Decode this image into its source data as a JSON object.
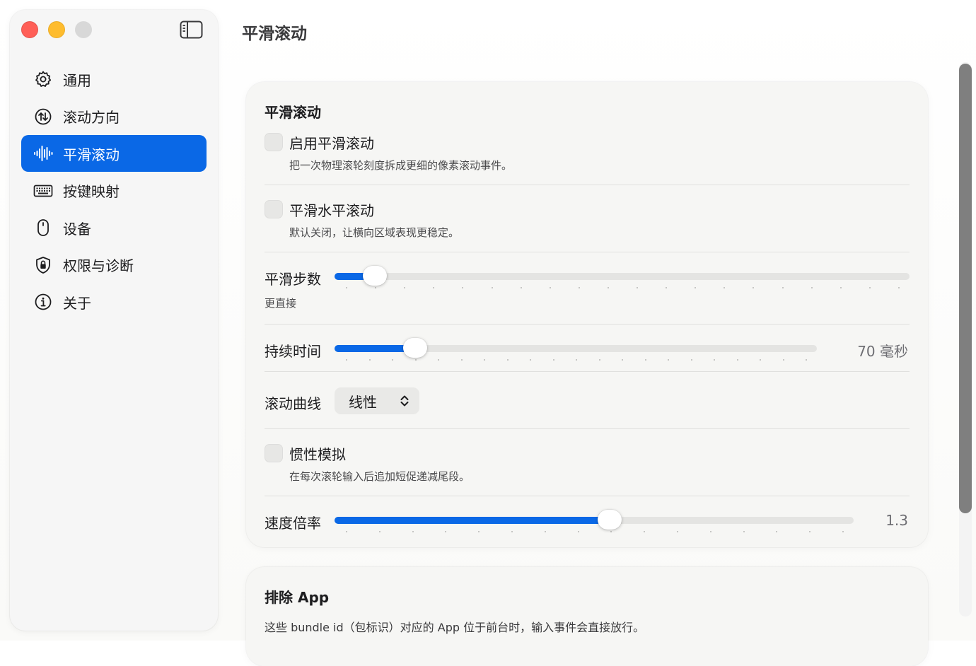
{
  "page": {
    "title": "平滑滚动"
  },
  "sidebar": {
    "items": [
      {
        "label": "通用",
        "icon": "gear-icon",
        "active": false
      },
      {
        "label": "滚动方向",
        "icon": "arrows-updown-circle-icon",
        "active": false
      },
      {
        "label": "平滑滚动",
        "icon": "waveform-icon",
        "active": true
      },
      {
        "label": "按键映射",
        "icon": "keyboard-icon",
        "active": false
      },
      {
        "label": "设备",
        "icon": "mouse-icon",
        "active": false
      },
      {
        "label": "权限与诊断",
        "icon": "lock-shield-icon",
        "active": false
      },
      {
        "label": "关于",
        "icon": "info-icon",
        "active": false
      }
    ]
  },
  "smooth": {
    "title": "平滑滚动",
    "enable": {
      "label": "启用平滑滚动",
      "desc": "把一次物理滚轮刻度拆成更细的像素滚动事件。",
      "checked": false
    },
    "horizontal": {
      "label": "平滑水平滚动",
      "desc": "默认关闭，让横向区域表现更稳定。",
      "checked": false
    },
    "steps": {
      "label": "平滑步数",
      "note": "更直接",
      "fraction": 0.07
    },
    "duration": {
      "label": "持续时间",
      "value_text": "70 毫秒",
      "fraction": 0.167
    },
    "curve": {
      "label": "滚动曲线",
      "value": "线性"
    },
    "inertia": {
      "label": "惯性模拟",
      "desc": "在每次滚轮输入后追加短促递减尾段。",
      "checked": false
    },
    "speed": {
      "label": "速度倍率",
      "value_text": "1.3",
      "fraction": 0.53
    }
  },
  "exclude": {
    "title": "排除 App",
    "desc": "这些 bundle id（包标识）对应的 App 位于前台时，输入事件会直接放行。"
  },
  "colors": {
    "accent": "#0a68e6",
    "close": "#ff5f57",
    "minimize": "#febc2e",
    "inactive": "#d8d8d8"
  }
}
